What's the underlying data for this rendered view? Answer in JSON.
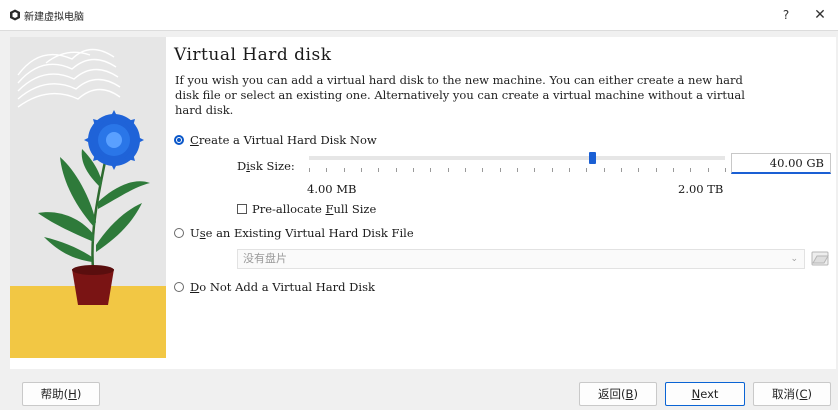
{
  "window": {
    "title": "新建虚拟电脑",
    "help": "?",
    "close": "✕"
  },
  "page": {
    "title": "Virtual Hard disk",
    "intro": "If you wish you can add a virtual hard disk to the new machine. You can either create a new hard disk file or select an existing one. Alternatively you can create a virtual machine without a virtual hard disk."
  },
  "options": {
    "create": {
      "label_prefix": "",
      "mnemonic": "C",
      "label_rest": "reate a Virtual Hard Disk Now",
      "selected": true
    },
    "existing": {
      "label_prefix": "U",
      "mnemonic": "s",
      "label_rest": "e an Existing Virtual Hard Disk File",
      "selected": false
    },
    "none": {
      "label_prefix": "",
      "mnemonic": "D",
      "label_rest": "o Not Add a Virtual Hard Disk",
      "selected": false
    }
  },
  "disk_size": {
    "label_prefix": "D",
    "mnemonic": "i",
    "label_rest": "sk Size:",
    "value": "40.00 GB",
    "min_label": "4.00 MB",
    "max_label": "2.00 TB",
    "slider_position": 0.68
  },
  "preallocate": {
    "label_prefix": "Pre-allocate ",
    "mnemonic": "F",
    "label_rest": "ull Size",
    "checked": false
  },
  "existing_disk": {
    "value": "没有盘片"
  },
  "buttons": {
    "help": {
      "text": "帮助(",
      "mnemonic": "H",
      "end": ")"
    },
    "back": {
      "text": "返回(",
      "mnemonic": "B",
      "end": ")"
    },
    "next": {
      "text": "",
      "mnemonic": "N",
      "end": "ext"
    },
    "cancel": {
      "text": "取消(",
      "mnemonic": "C",
      "end": ")"
    }
  },
  "colors": {
    "accent": "#1a5fd4",
    "flower": "#1f63d8",
    "pot": "#7a1414",
    "ground": "#f2c744"
  }
}
